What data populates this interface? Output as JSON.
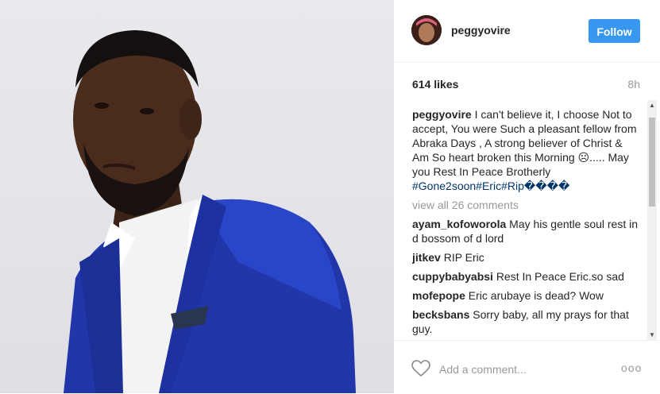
{
  "post": {
    "username": "peggyovire",
    "follow_label": "Follow",
    "likes": "614 likes",
    "time": "8h",
    "caption_user": "peggyovire",
    "caption_text": " I can't believe it, I choose Not to accept, You were Such a pleasant fellow from Abraka Days , A strong believer of Christ & Am So heart broken this Morning ☹..... May you Rest In Peace Brotherly ",
    "hashtags": "#Gone2soon#Eric#Rip",
    "caption_tail": "����",
    "view_all": "view all 26 comments",
    "comments": [
      {
        "user": "ayam_kofoworola",
        "text": "May his gentle soul rest in d bossom of d lord"
      },
      {
        "user": "jitkev",
        "text": "RIP Eric"
      },
      {
        "user": "cuppybabyabsi",
        "text": "Rest In Peace Eric.so sad"
      },
      {
        "user": "mofepope",
        "text": "Eric arubaye is dead? Wow"
      },
      {
        "user": "becksbans",
        "text": "Sorry baby, all my prays for that guy."
      }
    ],
    "add_comment_placeholder": "Add a comment...",
    "more_options": "ooo"
  },
  "icons": {
    "heart": "heart-icon",
    "scroll_up": "up-arrow",
    "scroll_down": "down-arrow"
  },
  "colors": {
    "follow_button": "#3897f0",
    "hashtag": "#003569",
    "muted": "#999999"
  }
}
